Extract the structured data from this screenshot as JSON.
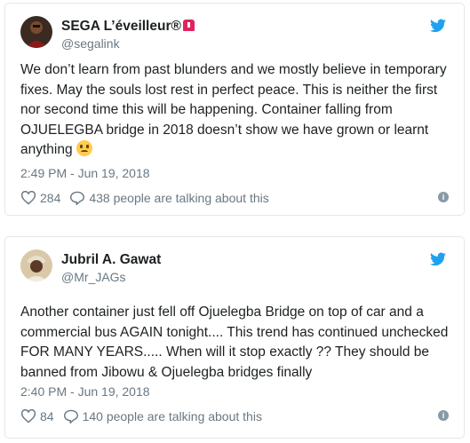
{
  "tweets": [
    {
      "author_name": "SEGA L’éveilleur®",
      "handle": "@segalink",
      "text": "We don’t learn from past blunders and we mostly believe in temporary fixes. May the souls lost rest in perfect peace. This is neither the first nor second time this will be happening. Container falling from OJUELEGBA bridge in 2018 doesn’t show we have grown or learnt anything",
      "emoji_icon": "disappointed-face-icon",
      "badge_icon": "siren-icon",
      "timestamp": "2:49 PM - Jun 19, 2018",
      "likes": "284",
      "talking": "438 people are talking about this"
    },
    {
      "author_name": "Jubril A. Gawat",
      "handle": "@Mr_JAGs",
      "text": "Another container just fell off Ojuelegba Bridge on top of car and a commercial bus AGAIN tonight.... This trend has continued unchecked FOR MANY YEARS..... When will it stop exactly ?? They should be banned from Jibowu & Ojuelegba bridges finally",
      "timestamp": "2:40 PM - Jun 19, 2018",
      "likes": "84",
      "talking": "140 people are talking about this"
    }
  ],
  "colors": {
    "text": "#1c2022",
    "muted": "#697882",
    "twitter_blue": "#1da1f2",
    "border": "#e1e8ed"
  },
  "icons": {
    "brand": "twitter-bird-icon",
    "like": "heart-icon",
    "reply": "speech-bubble-icon",
    "info": "info-icon"
  }
}
